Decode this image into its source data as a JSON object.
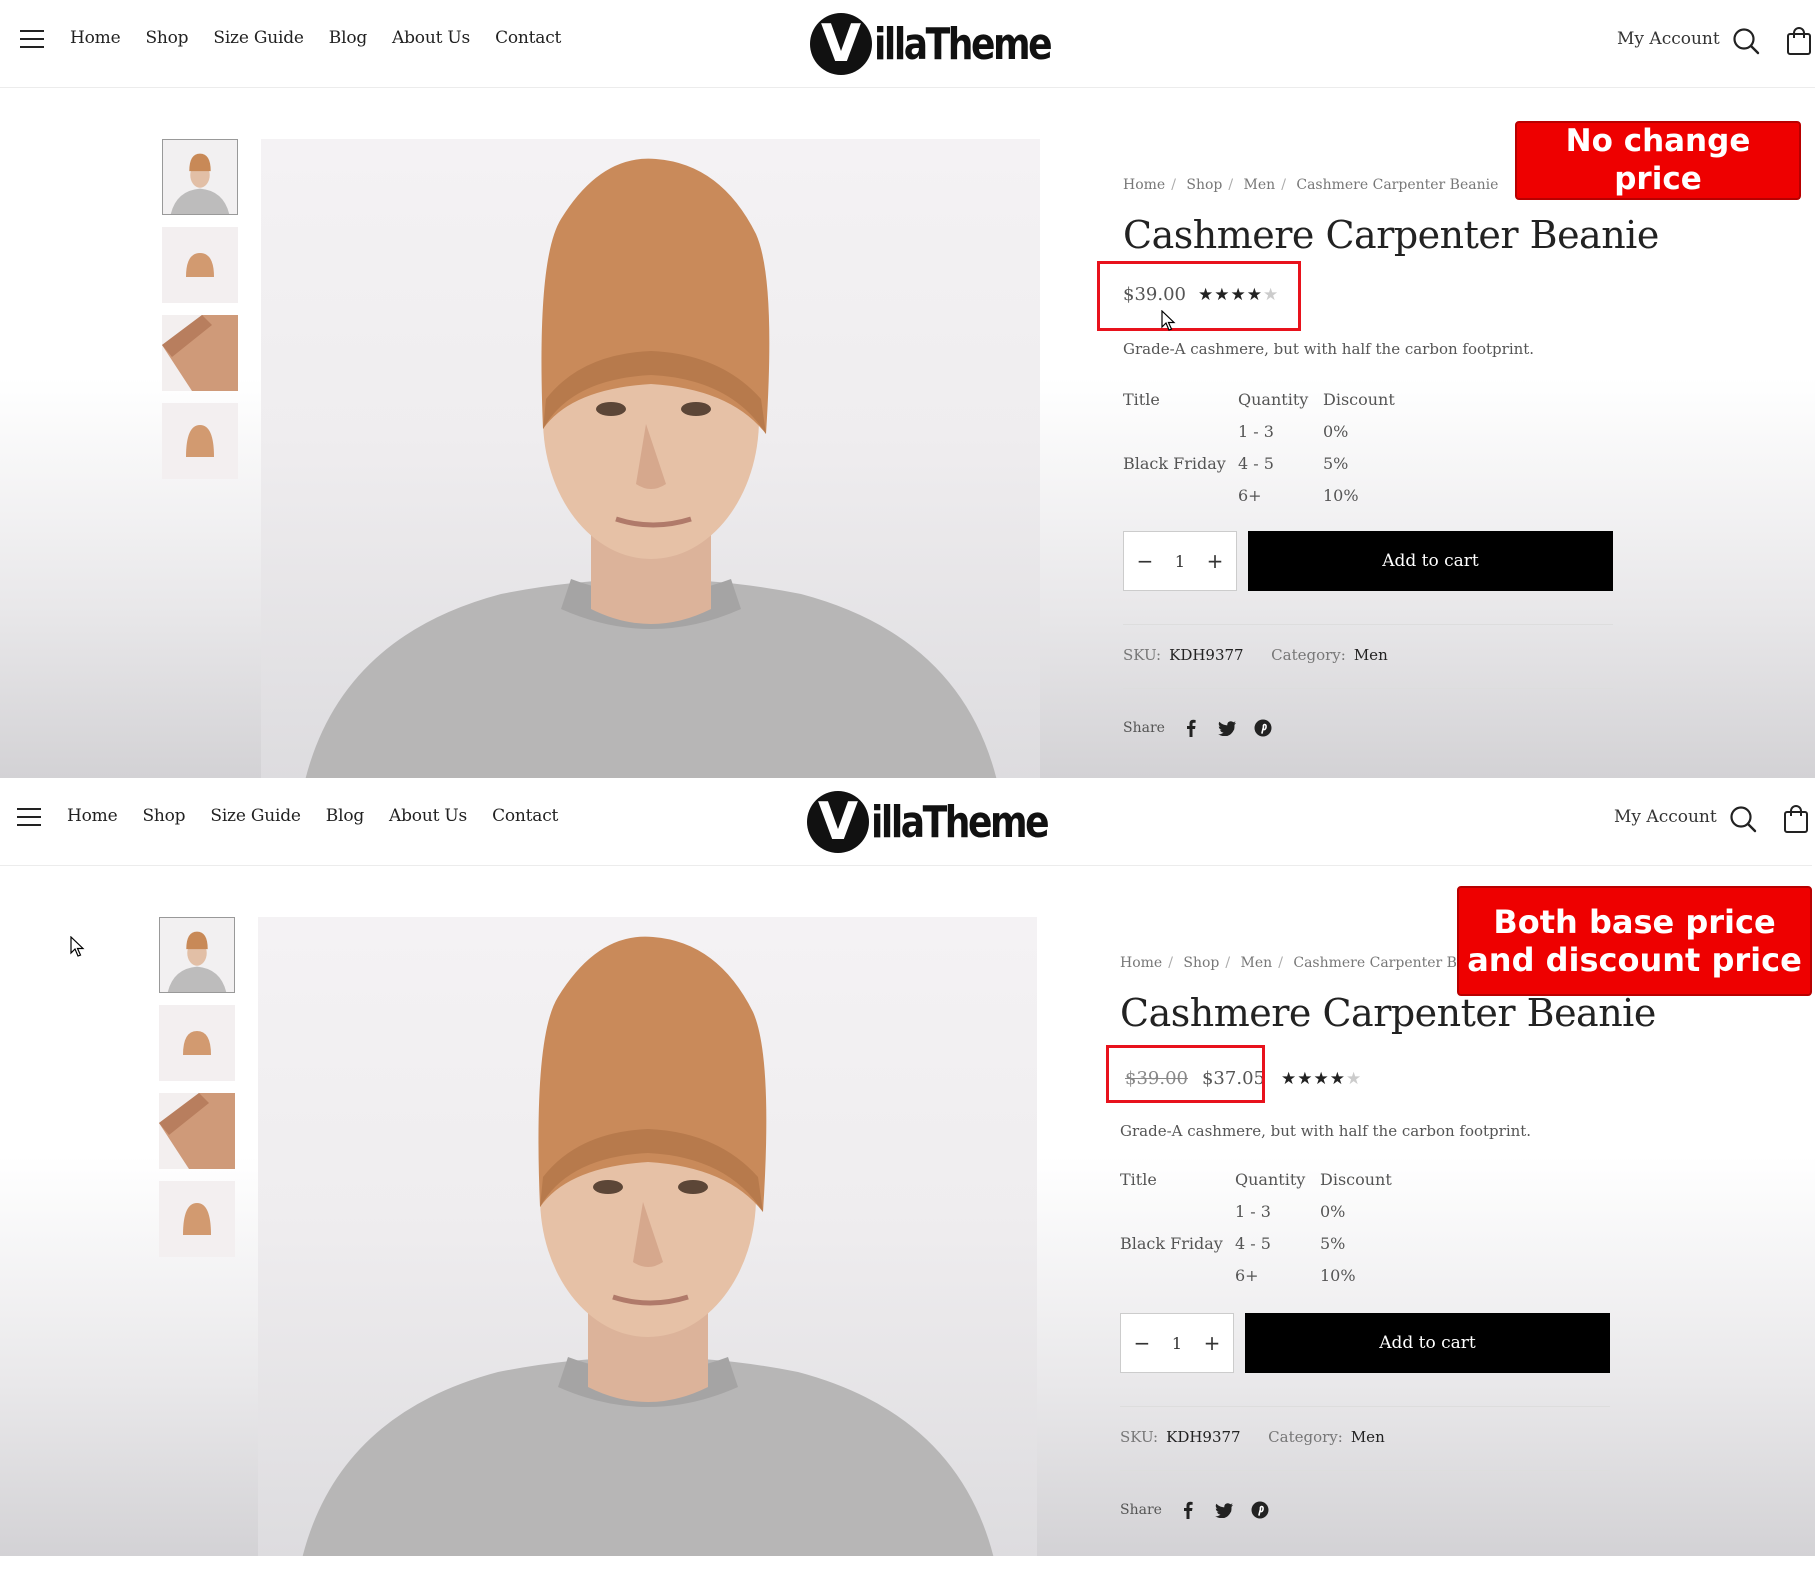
{
  "header": {
    "nav": [
      "Home",
      "Shop",
      "Size Guide",
      "Blog",
      "About Us",
      "Contact"
    ],
    "logo_mark": "V",
    "logo_text": "illaTheme",
    "my_account": "My Account"
  },
  "product": {
    "breadcrumb": [
      "Home",
      "Shop",
      "Men",
      "Cashmere Carpenter Beanie"
    ],
    "title": "Cashmere Carpenter Beanie",
    "short_description": "Grade-A cashmere, but with half the carbon footprint.",
    "rating_stars_filled": 4,
    "rating_stars_total": 5,
    "discount_table": {
      "headers": [
        "Title",
        "Quantity",
        "Discount"
      ],
      "rows": [
        {
          "title": "",
          "quantity": "1 - 3",
          "discount": "0%"
        },
        {
          "title": "Black Friday",
          "quantity": "4 - 5",
          "discount": "5%"
        },
        {
          "title": "",
          "quantity": "6+",
          "discount": "10%"
        }
      ]
    },
    "quantity": "1",
    "add_to_cart": "Add to cart",
    "sku_label": "SKU:",
    "sku": "KDH9377",
    "category_label": "Category:",
    "category": "Men",
    "share_label": "Share"
  },
  "panels": {
    "top": {
      "price": "$39.00",
      "callout": "No change price"
    },
    "bottom": {
      "price_old": "$39.00",
      "price": "$37.05",
      "callout_line1": "Both base price",
      "callout_line2": "and discount price"
    }
  },
  "colors": {
    "annotation_red": "#e8121c",
    "button_black": "#000000",
    "beanie": "#c98a5a"
  }
}
